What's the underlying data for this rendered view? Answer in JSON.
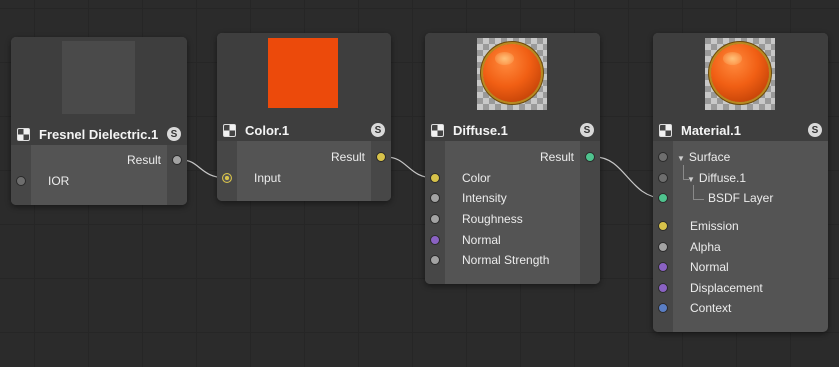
{
  "nodes": {
    "fresnel": {
      "title": "Fresnel Dielectric.1",
      "solo": "S",
      "output": "Result",
      "inputs": [
        "IOR"
      ]
    },
    "color": {
      "title": "Color.1",
      "solo": "S",
      "output": "Result",
      "inputs": [
        "Input"
      ],
      "swatch_color": "#ec4a0b"
    },
    "diffuse": {
      "title": "Diffuse.1",
      "solo": "S",
      "output": "Result",
      "inputs": [
        "Color",
        "Intensity",
        "Roughness",
        "Normal",
        "Normal Strength"
      ]
    },
    "material": {
      "title": "Material.1",
      "solo": "S",
      "layers": {
        "surface": "Surface",
        "diffuse": "Diffuse.1",
        "bsdf": "BSDF Layer"
      },
      "inputs": [
        "Emission",
        "Alpha",
        "Normal",
        "Displacement",
        "Context"
      ]
    }
  },
  "colors": {
    "wire": "#c8c8c8",
    "port_yellow": "#d7c24a",
    "port_green": "#4fc38e",
    "port_purple": "#8a62c3",
    "port_blue": "#5a7ec4"
  }
}
